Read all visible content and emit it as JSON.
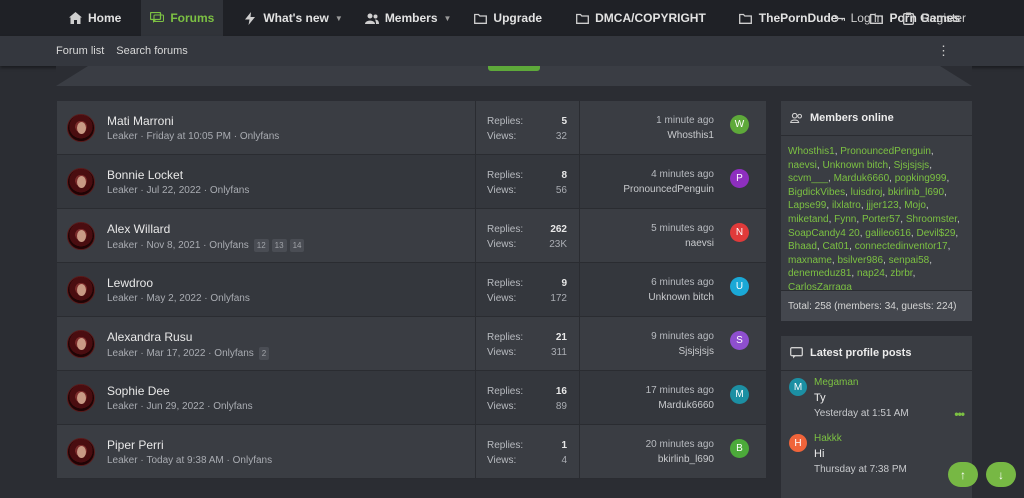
{
  "nav": {
    "home": "Home",
    "forums": "Forums",
    "whats_new": "What's new",
    "members": "Members",
    "upgrade": "Upgrade",
    "dmca": "DMCA/COPYRIGHT",
    "theporndude": "ThePornDude",
    "porn_games": "Porn Games",
    "login": "Log in",
    "register": "Register",
    "active_color": "#7cc143"
  },
  "subnav": {
    "forum_list": "Forum list",
    "search_forums": "Search forums",
    "more": "⋮"
  },
  "threads": [
    {
      "title": "Mati Marroni",
      "author": "Leaker",
      "date": "Friday at 10:05 PM",
      "forum": "Onlyfans",
      "pages": [],
      "replies_label": "Replies:",
      "replies": "5",
      "views_label": "Views:",
      "views": "32",
      "last_time": "1 minute ago",
      "last_user": "Whosthis1",
      "last_initial": "W",
      "last_color": "#5ea93a"
    },
    {
      "title": "Bonnie Locket",
      "author": "Leaker",
      "date": "Jul 22, 2022",
      "forum": "Onlyfans",
      "pages": [],
      "replies_label": "Replies:",
      "replies": "8",
      "views_label": "Views:",
      "views": "56",
      "last_time": "4 minutes ago",
      "last_user": "PronouncedPenguin",
      "last_initial": "P",
      "last_color": "#8e2fbf"
    },
    {
      "title": "Alex Willard",
      "author": "Leaker",
      "date": "Nov 8, 2021",
      "forum": "Onlyfans",
      "pages": [
        "12",
        "13",
        "14"
      ],
      "replies_label": "Replies:",
      "replies": "262",
      "views_label": "Views:",
      "views": "23K",
      "last_time": "5 minutes ago",
      "last_user": "naevsi",
      "last_initial": "N",
      "last_color": "#e03a3a"
    },
    {
      "title": "Lewdroo",
      "author": "Leaker",
      "date": "May 2, 2022",
      "forum": "Onlyfans",
      "pages": [],
      "replies_label": "Replies:",
      "replies": "9",
      "views_label": "Views:",
      "views": "172",
      "last_time": "6 minutes ago",
      "last_user": "Unknown bitch",
      "last_initial": "U",
      "last_color": "#1aa8d6"
    },
    {
      "title": "Alexandra Rusu",
      "author": "Leaker",
      "date": "Mar 17, 2022",
      "forum": "Onlyfans",
      "pages": [
        "2"
      ],
      "replies_label": "Replies:",
      "replies": "21",
      "views_label": "Views:",
      "views": "311",
      "last_time": "9 minutes ago",
      "last_user": "Sjsjsjsjs",
      "last_initial": "S",
      "last_color": "#8e4fcf"
    },
    {
      "title": "Sophie Dee",
      "author": "Leaker",
      "date": "Jun 29, 2022",
      "forum": "Onlyfans",
      "pages": [],
      "replies_label": "Replies:",
      "replies": "16",
      "views_label": "Views:",
      "views": "89",
      "last_time": "17 minutes ago",
      "last_user": "Marduk6660",
      "last_initial": "M",
      "last_color": "#1c8fa3"
    },
    {
      "title": "Piper Perri",
      "author": "Leaker",
      "date": "Today at 9:38 AM",
      "forum": "Onlyfans",
      "pages": [],
      "replies_label": "Replies:",
      "replies": "1",
      "views_label": "Views:",
      "views": "4",
      "last_time": "20 minutes ago",
      "last_user": "bkirlinb_l690",
      "last_initial": "B",
      "last_color": "#4caa3a"
    }
  ],
  "members_online": {
    "title": "Members online",
    "names": [
      "Whosthis1",
      "PronouncedPenguin",
      "naevsi",
      "Unknown bitch",
      "Sjsjsjsjs",
      "scvm___",
      "Marduk6660",
      "popking999",
      "BigdickVibes",
      "luisdroj",
      "bkirlinb_l690",
      "Lapse99",
      "ilxlatro",
      "jjjer123",
      "Mojo",
      "miketand",
      "Fynn",
      "Porter57",
      "Shroomster",
      "SoapCandy4 20",
      "galileo616",
      "Devil$29",
      "Bhaad",
      "Cat01",
      "connectedinventor17",
      "maxname",
      "bsilver986",
      "senpai58",
      "denemeduz81",
      "nap24",
      "zbrbr",
      "CarlosZarraga"
    ],
    "total": "Total: 258 (members: 34, guests: 224)"
  },
  "latest_posts": {
    "title": "Latest profile posts",
    "posts": [
      {
        "name": "Megaman",
        "initial": "M",
        "color": "#1c8fa3",
        "text": "Ty",
        "time": "Yesterday at 1:51 AM",
        "more": "•••"
      },
      {
        "name": "Hakkk",
        "initial": "H",
        "color": "#f0643a",
        "text": "Hi",
        "time": "Thursday at 7:38 PM",
        "more": ""
      }
    ]
  },
  "fab": {
    "up": "↑",
    "down": "↓"
  }
}
